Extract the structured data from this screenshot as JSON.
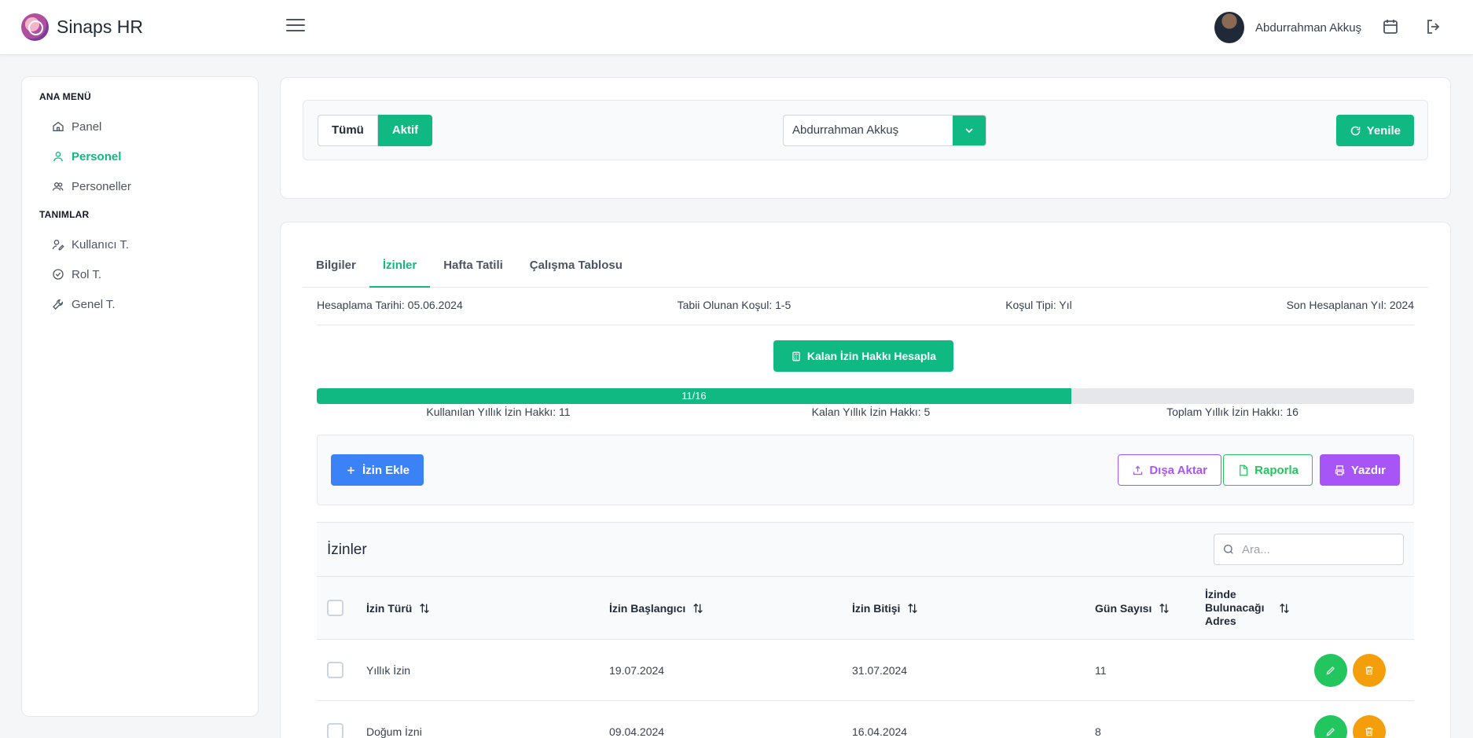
{
  "app": {
    "title": "Sinaps HR"
  },
  "header": {
    "user_name": "Abdurrahman Akkuş"
  },
  "sidebar": {
    "sections": [
      {
        "heading": "ANA MENÜ",
        "items": [
          {
            "label": "Panel",
            "icon": "home-icon"
          },
          {
            "label": "Personel",
            "icon": "user-icon",
            "active": true
          },
          {
            "label": "Personeller",
            "icon": "users-icon"
          }
        ]
      },
      {
        "heading": "TANIMLAR",
        "items": [
          {
            "label": "Kullanıcı T.",
            "icon": "user-edit-icon"
          },
          {
            "label": "Rol T.",
            "icon": "check-circle-icon"
          },
          {
            "label": "Genel T.",
            "icon": "wrench-icon"
          }
        ]
      }
    ]
  },
  "filter": {
    "segment": {
      "all_label": "Tümü",
      "active_label": "Aktif",
      "selected": "Aktif"
    },
    "person_select": {
      "value": "Abdurrahman Akkuş"
    },
    "refresh_label": "Yenile"
  },
  "tabs": [
    {
      "label": "Bilgiler"
    },
    {
      "label": "İzinler",
      "active": true
    },
    {
      "label": "Hafta Tatili"
    },
    {
      "label": "Çalışma Tablosu"
    }
  ],
  "info": {
    "calc_date": "Hesaplama Tarihi: 05.06.2024",
    "condition": "Tabii Olunan Koşul: 1-5",
    "condition_type": "Koşul Tipi: Yıl",
    "last_year": "Son Hesaplanan Yıl: 2024"
  },
  "calc_button_label": "Kalan İzin Hakkı Hesapla",
  "leave_progress": {
    "used": 11,
    "total": 16,
    "bar_text": "11/16",
    "used_label": "Kullanılan Yıllık İzin Hakkı: 11",
    "remaining_label": "Kalan Yıllık İzin Hakkı: 5",
    "total_label": "Toplam Yıllık İzin Hakkı: 16"
  },
  "actions": {
    "add_label": "İzin Ekle",
    "export_label": "Dışa Aktar",
    "report_label": "Raporla",
    "print_label": "Yazdır"
  },
  "table": {
    "title": "İzinler",
    "search_placeholder": "Ara...",
    "columns": [
      "İzin Türü",
      "İzin Başlangıcı",
      "İzin Bitişi",
      "Gün Sayısı",
      "İzinde Bulunacağı Adres"
    ],
    "rows": [
      {
        "type": "Yıllık İzin",
        "start": "19.07.2024",
        "end": "31.07.2024",
        "days": "11",
        "address": ""
      },
      {
        "type": "Doğum İzni",
        "start": "09.04.2024",
        "end": "16.04.2024",
        "days": "8",
        "address": ""
      }
    ]
  },
  "colors": {
    "accent": "#10b981",
    "primary": "#3b82f6",
    "purple": "#a855f7",
    "warning": "#f59e0b"
  }
}
